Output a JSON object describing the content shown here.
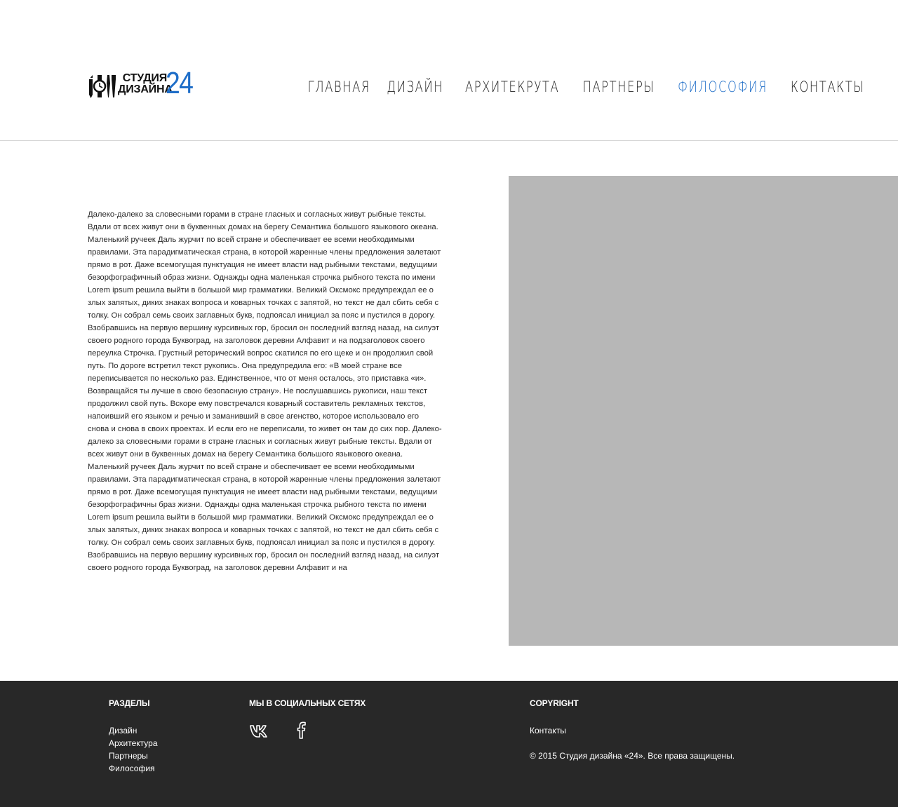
{
  "logo": {
    "line1": "СТУДИЯ",
    "line2": "ДИЗАЙНА",
    "number": "24",
    "icon": "tools-icon"
  },
  "nav": {
    "items": [
      {
        "label": "Главная"
      },
      {
        "label": "Дизайн"
      },
      {
        "label": "Архитекрута"
      },
      {
        "label": "Партнеры"
      },
      {
        "label": "Философия"
      },
      {
        "label": "Контакты"
      }
    ],
    "active_index": 4
  },
  "colors": {
    "accent": "#1f6ec8",
    "footer_bg": "#282828",
    "photo_placeholder": "#b7b7b7"
  },
  "article": {
    "text": "Далеко-далеко за словесными горами в стране гласных и согласных живут рыбные тексты. Вдали от всех живут они в буквенных домах на берегу Семантика большого языкового океана. Маленький ручеек Даль журчит по всей стране и обеспечивает ее всеми необходимыми правилами. Эта парадигматическая страна, в которой жаренные члены предложения залетают прямо в рот. Даже всемогущая пунктуация не имеет власти над рыбными текстами, ведущими безорфографичный образ жизни. Однажды одна маленькая строчка рыбного текста по имени Lorem ipsum решила выйти в большой мир грамматики. Великий Оксмокс предупреждал ее о злых запятых, диких знаках вопроса и коварных точках с запятой, но текст не дал сбить себя с толку. Он собрал семь своих заглавных букв, подпоясал инициал за пояс и пустился в дорогу. Взобравшись на первую вершину курсивных гор, бросил он последний взгляд назад, на силуэт своего родного города Буквоград, на заголовок деревни Алфавит и на подзаголовок своего переулка Строчка. Грустный реторический вопрос скатился по его щеке и он продолжил свой путь. По дороге встретил текст рукопись. Она предупредила его: «В моей стране все переписывается по несколько раз. Единственное, что от меня осталось, это приставка «и». Возвращайся ты лучше в свою безопасную страну». Не послушавшись рукописи, наш текст продолжил свой путь. Вскоре ему повстречался коварный составитель рекламных текстов, напоивший его языком и речью и заманивший в свое агенство, которое использовало его снова и снова в своих проектах. И если его не переписали, то живет он там до сих пор. Далеко-далеко за словесными горами в стране гласных и согласных живут рыбные тексты. Вдали от всех живут они в буквенных домах на берегу Семантика большого языкового океана. Маленький ручеек Даль журчит по всей стране и обеспечивает ее всеми необходимыми правилами. Эта парадигматическая страна, в которой жаренные члены предложения залетают прямо в рот. Даже всемогущая пунктуация не имеет власти над рыбными текстами, ведущими безорфографичны браз жизни. Однажды одна маленькая строчка рыбного текста по имени Lorem ipsum решила выйти в большой мир грамматики. Великий Оксмокс предупреждал ее о злых запятых, диких знаках вопроса и коварных точках с запятой, но текст не дал сбить себя с толку. Он собрал семь своих заглавных букв, подпоясал инициал за пояс и пустился в дорогу. Взобравшись на первую вершину курсивных гор, бросил он последний взгляд назад, на силуэт своего родного города Буквоград, на заголовок деревни Алфавит и на"
  },
  "footer": {
    "sections": {
      "title": "РАЗДЕЛЫ",
      "links": [
        "Дизайн",
        "Архитектура",
        "Партнеры",
        "Философия"
      ]
    },
    "social": {
      "title": "МЫ В СОЦИАЛЬНЫХ СЕТЯХ",
      "icons": [
        "vk-icon",
        "facebook-icon"
      ]
    },
    "copyright": {
      "title": "COPYRIGHT",
      "contacts": "Контакты",
      "notice": "© 2015 Студия дизайна «24». Все права защищены."
    }
  }
}
